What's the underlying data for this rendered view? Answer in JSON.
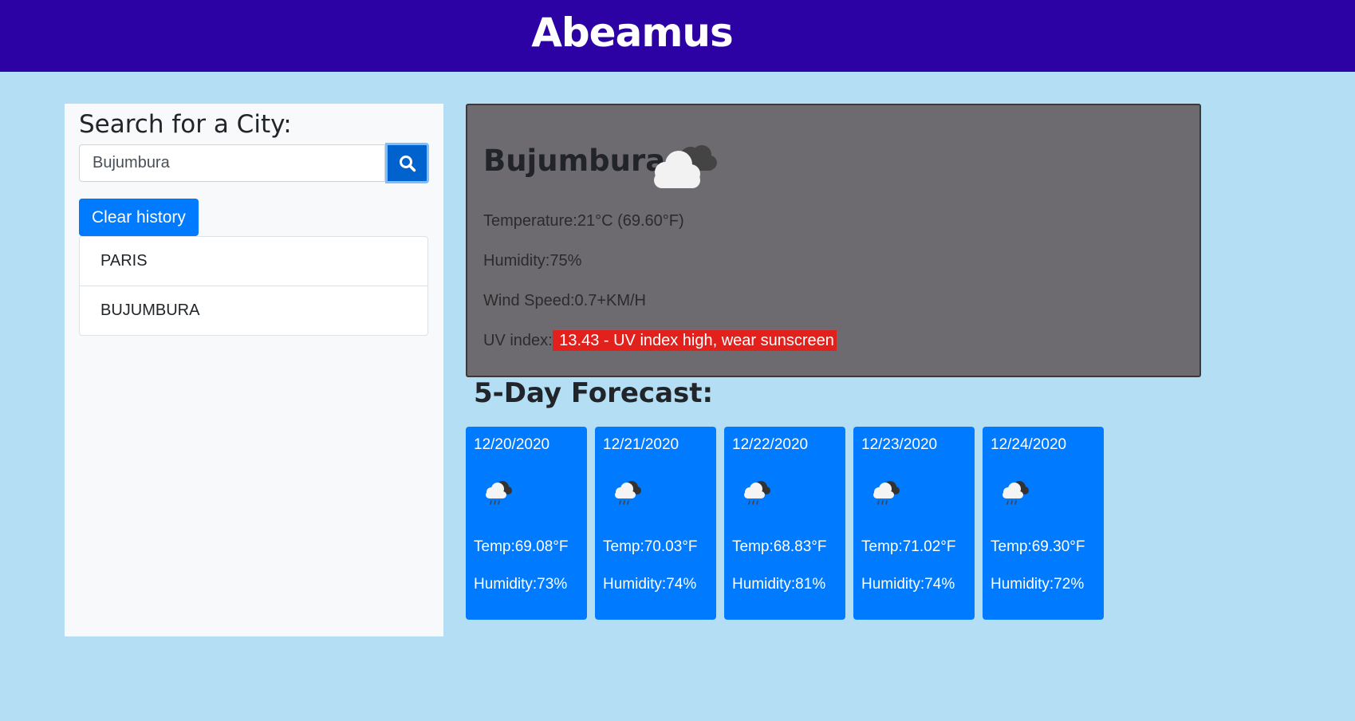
{
  "header": {
    "title": "Abeamus"
  },
  "search": {
    "heading": "Search for a City:",
    "value": "Bujumbura",
    "clear_label": "Clear history",
    "history": [
      "PARIS",
      "BUJUMBURA"
    ]
  },
  "current": {
    "city": "Bujumbura",
    "icon": "cloudy-icon",
    "temperature": "Temperature:21°C (69.60°F)",
    "humidity": "Humidity:75%",
    "wind": "Wind Speed:0.7+KM/H",
    "uv_label": "UV index:",
    "uv_value": " 13.43 - UV index high, wear sunscreen",
    "uv_color": "#e2211c"
  },
  "forecast": {
    "title": "5-Day Forecast:",
    "days": [
      {
        "date": "12/20/2020",
        "icon": "rain-icon",
        "temp": "Temp:69.08°F",
        "humidity": "Humidity:73%"
      },
      {
        "date": "12/21/2020",
        "icon": "rain-icon",
        "temp": "Temp:70.03°F",
        "humidity": "Humidity:74%"
      },
      {
        "date": "12/22/2020",
        "icon": "rain-icon",
        "temp": "Temp:68.83°F",
        "humidity": "Humidity:81%"
      },
      {
        "date": "12/23/2020",
        "icon": "rain-icon",
        "temp": "Temp:71.02°F",
        "humidity": "Humidity:74%"
      },
      {
        "date": "12/24/2020",
        "icon": "rain-icon",
        "temp": "Temp:69.30°F",
        "humidity": "Humidity:72%"
      }
    ]
  },
  "colors": {
    "header_bg": "#2c02a4",
    "page_bg": "#b3def3",
    "card_bg": "#007bff",
    "current_bg": "#6d6b70"
  }
}
